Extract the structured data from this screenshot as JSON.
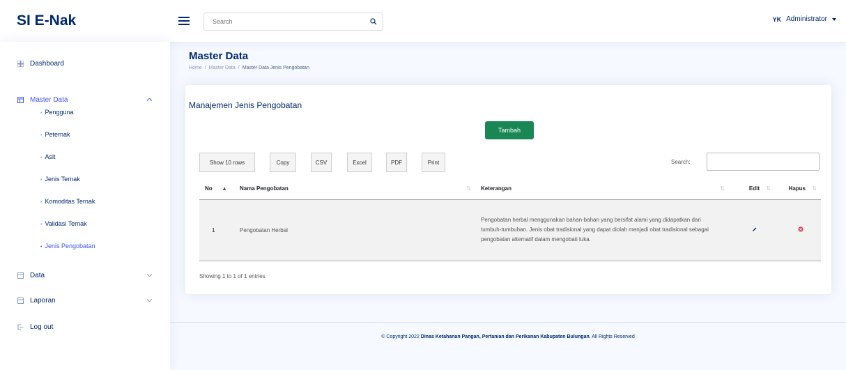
{
  "app": {
    "title": "SI E-Nak"
  },
  "header": {
    "search_placeholder": "Search",
    "user_initials": "YK",
    "user_name": "Administrator"
  },
  "sidebar": {
    "dashboard": "Dashboard",
    "master_data": "Master Data",
    "sub_items": [
      "Pengguna",
      "Peternak",
      "Asit",
      "Jenis Ternak",
      "Komoditas Ternak",
      "Validasi Ternak",
      "Jenis Pengobatan"
    ],
    "data": "Data",
    "laporan": "Laporan",
    "logout": "Log out"
  },
  "page": {
    "title": "Master Data",
    "breadcrumb": {
      "home": "Home",
      "sep": "/",
      "section": "Master Data",
      "current": "Master Data Jenis Pengobatan"
    }
  },
  "card": {
    "title": "Manajemen Jenis Pengobatan",
    "add_button": "Tambah",
    "buttons": {
      "show_rows": "Show 10 rows",
      "copy": "Copy",
      "csv": "CSV",
      "excel": "Excel",
      "pdf": "PDF",
      "print": "Print"
    },
    "search_label": "Search:",
    "columns": {
      "no": "No",
      "nama": "Nama Pengobatan",
      "keterangan": "Keterangan",
      "edit": "Edit",
      "hapus": "Hapus"
    },
    "rows": [
      {
        "no": "1",
        "nama": "Pengobatan Herbal",
        "keterangan": "Pengobatan herbal menggunakan bahan-bahan yang bersifat alami yang didapatkan dari tumbuh-tumbuhan. Jenis obat tradisional yang dapat diolah menjadi obat tradisional sebagai pengobatan alternatif dalam mengobati luka."
      }
    ],
    "info": "Showing 1 to 1 of 1 entries"
  },
  "footer": {
    "prefix": "© Copyright 2022",
    "org": "Dinas Ketahanan Pangan, Pertanian dan Perikanan Kabupaten Bulungan",
    "suffix": ". All Rights Reserved"
  },
  "colors": {
    "brand": "#012970",
    "accent": "#4154f1",
    "success": "#198754",
    "danger": "#dc3545"
  }
}
